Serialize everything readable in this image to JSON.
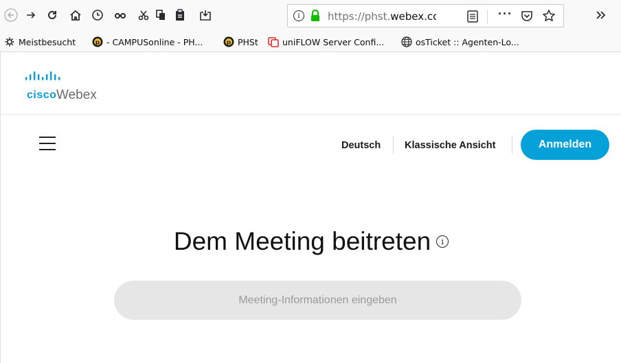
{
  "browser": {
    "url_prefix": "https://phst.",
    "url_domain": "webex.co",
    "icons": [
      "back-icon",
      "forward-icon",
      "reload-icon",
      "home-icon",
      "history-icon",
      "glasses-icon",
      "cut-icon",
      "copy-icon",
      "paste-icon",
      "screenshot-icon",
      "info-icon",
      "lock-icon",
      "reader-view-icon",
      "more-icon",
      "pocket-icon",
      "star-icon",
      "overflow-icon"
    ]
  },
  "bookmarks": {
    "items": [
      {
        "label": "Meistbesucht",
        "icon": "gear-icon"
      },
      {
        "label": "- CAMPUSonline - PH...",
        "icon": "campus-icon"
      },
      {
        "label": "PHSt",
        "icon": "campus-icon"
      },
      {
        "label": "uniFLOW Server Confi...",
        "icon": "uniflow-icon"
      },
      {
        "label": "osTicket :: Agenten-Lo...",
        "icon": "globe-icon"
      }
    ]
  },
  "header": {
    "logo_brand": "cisco",
    "logo_product": "Webex"
  },
  "nav": {
    "language": "Deutsch",
    "classic_view": "Klassische Ansicht",
    "sign_in": "Anmelden"
  },
  "main": {
    "title": "Dem Meeting beitreten",
    "info_glyph": "i",
    "input_placeholder": "Meeting-Informationen eingeben"
  },
  "colors": {
    "accent": "#07a1d9",
    "cisco_blue": "#049fd9",
    "input_bg": "#e6e6e6"
  }
}
